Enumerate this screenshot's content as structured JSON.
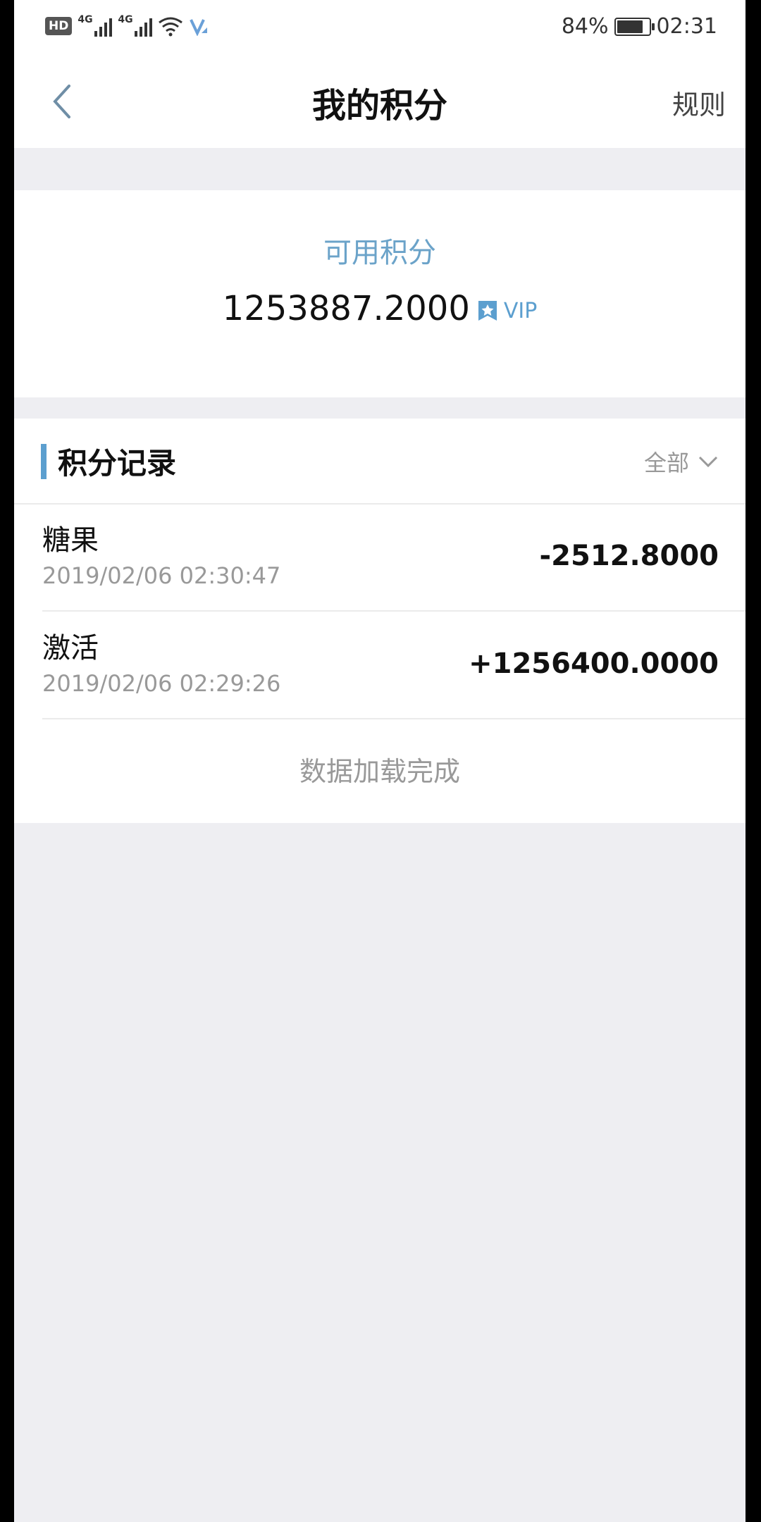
{
  "status_bar": {
    "hd": "HD",
    "net1": "4G",
    "net2": "4G",
    "battery_pct": "84%",
    "battery_level": 0.84,
    "time": "02:31"
  },
  "nav": {
    "back_icon": "chevron-left-icon",
    "title": "我的积分",
    "rules": "规则"
  },
  "points": {
    "label": "可用积分",
    "value": "1253887.2000",
    "vip_icon": "vip-star-icon",
    "vip_label": "VIP"
  },
  "records": {
    "title": "积分记录",
    "filter": "全部",
    "items": [
      {
        "name": "糖果",
        "time": "2019/02/06 02:30:47",
        "amount": "-2512.8000"
      },
      {
        "name": "激活",
        "time": "2019/02/06 02:29:26",
        "amount": "+1256400.0000"
      }
    ],
    "footer": "数据加载完成"
  },
  "colors": {
    "accent": "#5c9fcf",
    "page_bg": "#eeeef2",
    "text_secondary": "#999999"
  }
}
